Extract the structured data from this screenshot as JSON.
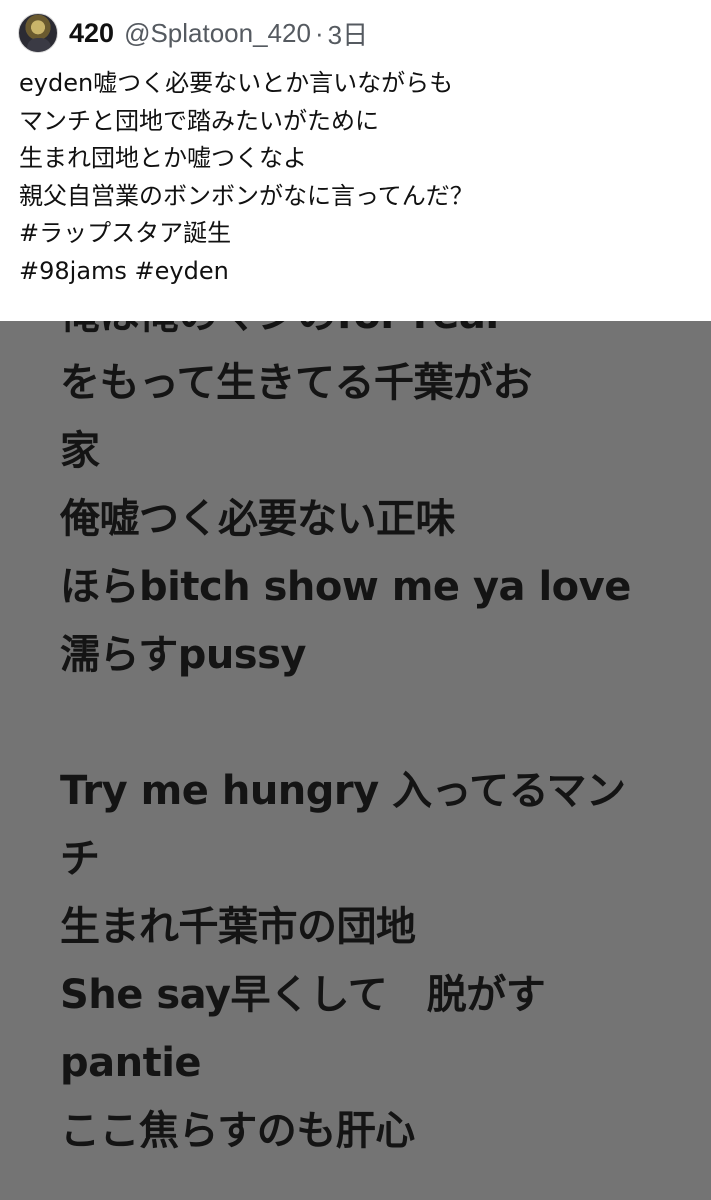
{
  "post": {
    "author": {
      "display_name": "420",
      "handle": "@Splatoon_420",
      "separator": "·",
      "timestamp": "3日"
    },
    "text_lines": [
      "eyden嘘つく必要ないとか言いながらも",
      "マンチと団地で踏みたいがために",
      "生まれ団地とか嘘つくなよ",
      "親父自営業のボンボンがなに言ってんだ？",
      "#ラップスタア誕生",
      "#98jams #eyden"
    ]
  },
  "lyrics_image": {
    "lines": [
      "俺は俺のマンのfor real",
      "をもって生きてる千葉がお",
      "家",
      "俺嘘つく必要ない正味",
      "ほらbitch show me ya love",
      "濡らすpussy",
      "",
      "Try me hungry 入ってるマン",
      "チ",
      "生まれ千葉市の団地",
      "She say早くして　脱がす",
      "pantie",
      "ここ焦らすのも肝心"
    ],
    "background_color": "#747474",
    "text_color": "#141414"
  }
}
